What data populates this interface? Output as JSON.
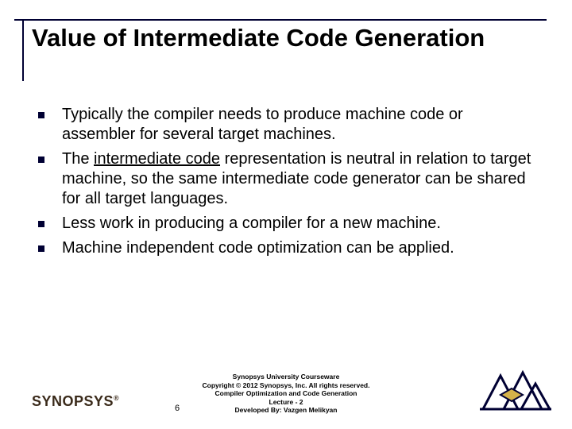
{
  "title": "Value of Intermediate Code Generation",
  "bullets": [
    {
      "pre": "Typically the compiler needs to produce machine code or assembler for several target machines.",
      "underlined": "",
      "post": ""
    },
    {
      "pre": "The ",
      "underlined": "intermediate code",
      "post": " representation is neutral in relation to target machine, so the same intermediate code generator can be shared for all target languages."
    },
    {
      "pre": "Less work in producing a compiler for a new machine.",
      "underlined": "",
      "post": ""
    },
    {
      "pre": "Machine independent code optimization can be applied.",
      "underlined": "",
      "post": ""
    }
  ],
  "footer": {
    "logo_text": "SYNOPSYS",
    "logo_reg": "®",
    "page_number": "6",
    "credits": {
      "l1": "Synopsys University Courseware",
      "l2": "Copyright © 2012 Synopsys, Inc. All rights reserved.",
      "l3": "Compiler Optimization and Code Generation",
      "l4": "Lecture - 2",
      "l5": "Developed By: Vazgen Melikyan"
    }
  }
}
